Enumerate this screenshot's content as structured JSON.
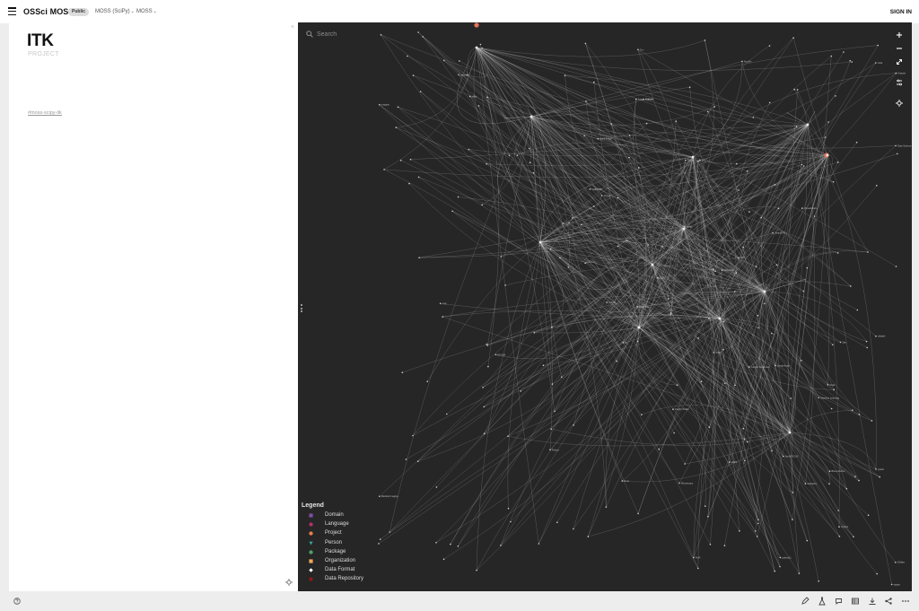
{
  "header": {
    "app_title": "OSSci MOSS",
    "badge": "Public",
    "breadcrumbs": [
      {
        "label": "MOSS (SciPy)"
      },
      {
        "label": "MOSS"
      }
    ],
    "sign_in_label": "SIGN IN"
  },
  "detail": {
    "title": "ITK",
    "type_label": "PROJECT",
    "tag": "#moss-scipy-itk"
  },
  "graph": {
    "search_placeholder": "Search",
    "node_labels": [
      "Python",
      "NumPy",
      "SciPy",
      "Jupyter",
      "scikit-image",
      "matplotlib",
      "Dask",
      "xarray",
      "pandas",
      "Cython",
      "ITK",
      "VTK",
      "Insight Toolkit",
      "C++",
      "CMake",
      "Zarr",
      "napari",
      "pybind11",
      "SimpleITK",
      "NetworkX",
      "conda-forge",
      "PyPI",
      "HDF5",
      "GitHub",
      "Kitware",
      "NumFOCUS",
      "scikit-learn",
      "Sphinx",
      "pytest",
      "OpenCV",
      "Pillow",
      "imageio",
      "tifffile",
      "nibabel",
      "DICOM",
      "NIfTI",
      "Bioconductor",
      "Julia",
      "R",
      "Rust",
      "Jupyter Notebook",
      "Image Analysis",
      "Medical Imaging",
      "Data Science",
      "Visualization",
      "Statistics",
      "Machine Learning",
      "Microscopy"
    ],
    "highlight_color": "#e8725c",
    "edge_color": "#d8d8d8"
  },
  "legend": {
    "title": "Legend",
    "items": [
      {
        "label": "Domain",
        "color": "#7b4fa8",
        "shape": "square"
      },
      {
        "label": "Language",
        "color": "#b0306b",
        "shape": "circle"
      },
      {
        "label": "Project",
        "color": "#e8814a",
        "shape": "circle"
      },
      {
        "label": "Person",
        "color": "#3aa6a0",
        "shape": "triangle"
      },
      {
        "label": "Package",
        "color": "#4f9f6a",
        "shape": "circle"
      },
      {
        "label": "Organization",
        "color": "#f0a85a",
        "shape": "square"
      },
      {
        "label": "Data Format",
        "color": "#ffffff",
        "shape": "diamond"
      },
      {
        "label": "Data Repository",
        "color": "#8a1a1a",
        "shape": "circle"
      }
    ]
  },
  "icons": {
    "menu": "hamburger-icon",
    "close": "close-icon",
    "search": "search-icon",
    "zoom_in": "plus-icon",
    "zoom_out": "minus-icon",
    "fit": "expand-icon",
    "settings": "sliders-icon",
    "focus": "crosshair-icon",
    "help": "help-icon"
  }
}
